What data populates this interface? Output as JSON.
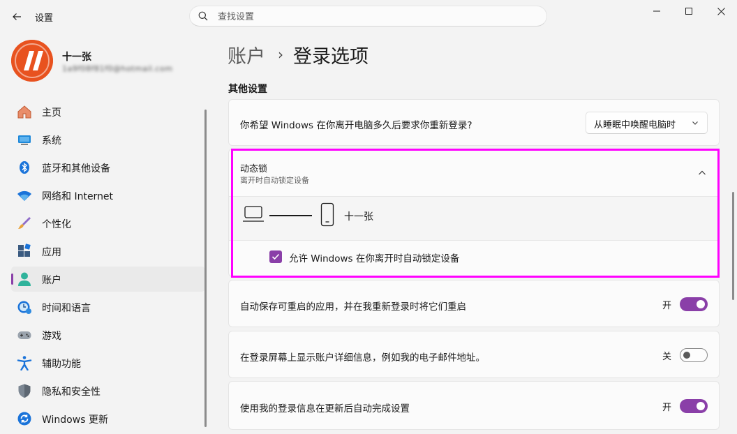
{
  "app": {
    "title": "设置"
  },
  "search": {
    "placeholder": "查找设置"
  },
  "profile": {
    "name": "十一张",
    "email": "1a9f08f81f0@hotmail.com"
  },
  "nav": {
    "items": [
      {
        "label": "主页",
        "icon": "home-icon"
      },
      {
        "label": "系统",
        "icon": "system-icon"
      },
      {
        "label": "蓝牙和其他设备",
        "icon": "bluetooth-icon"
      },
      {
        "label": "网络和 Internet",
        "icon": "wifi-icon"
      },
      {
        "label": "个性化",
        "icon": "brush-icon"
      },
      {
        "label": "应用",
        "icon": "apps-icon"
      },
      {
        "label": "账户",
        "icon": "account-icon",
        "active": true
      },
      {
        "label": "时间和语言",
        "icon": "time-language-icon"
      },
      {
        "label": "游戏",
        "icon": "gamepad-icon"
      },
      {
        "label": "辅助功能",
        "icon": "accessibility-icon"
      },
      {
        "label": "隐私和安全性",
        "icon": "shield-icon"
      },
      {
        "label": "Windows 更新",
        "icon": "update-icon"
      }
    ]
  },
  "breadcrumb": {
    "parent": "账户",
    "separator": "›",
    "current": "登录选项"
  },
  "section": {
    "title": "其他设置"
  },
  "relogin": {
    "text": "你希望 Windows 在你离开电脑多久后要求你重新登录?",
    "dropdown_value": "从睡眠中唤醒电脑时"
  },
  "dynamic_lock": {
    "title": "动态锁",
    "subtitle": "离开时自动锁定设备",
    "device_name": "十一张",
    "checkbox_label": "允许 Windows 在你离开时自动锁定设备",
    "checked": true
  },
  "settings": [
    {
      "text": "自动保存可重启的应用，并在我重新登录时将它们重启",
      "state": "开",
      "on": true
    },
    {
      "text": "在登录屏幕上显示账户详细信息，例如我的电子邮件地址。",
      "state": "关",
      "on": false
    },
    {
      "text": "使用我的登录信息在更新后自动完成设置",
      "state": "开",
      "on": true
    }
  ],
  "colors": {
    "accent": "#8a3fa8",
    "highlight": "#ff00ff",
    "avatar_bg": "#e8521f"
  }
}
